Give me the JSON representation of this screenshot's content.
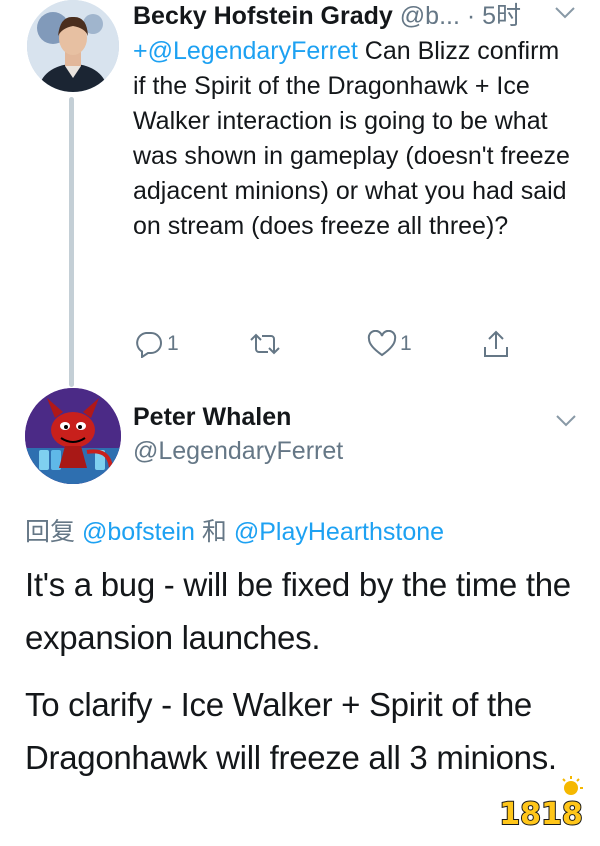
{
  "reply_tweet": {
    "author_name": "Becky Hofstein Grady",
    "author_handle": "@b...",
    "separator": "·",
    "time": "5时",
    "mention": "+@LegendaryFerret",
    "text": " Can Blizz confirm if the Spirit of the Dragonhawk + Ice Walker interaction is going to be what was shown in gameplay (doesn't freeze adjacent minions) or what you had said on stream (does freeze all three)?",
    "replies_count": "1",
    "likes_count": "1",
    "icons": [
      "reply-icon",
      "retweet-icon",
      "like-icon",
      "share-icon",
      "chevron-down-icon"
    ]
  },
  "main_tweet": {
    "author_name": "Peter Whalen",
    "author_handle": "@LegendaryFerret",
    "reply_prefix": "回复",
    "reply_to_1": "@bofstein",
    "reply_join": "和",
    "reply_to_2": "@PlayHearthstone",
    "paragraph_1": "It's a bug - will be fixed by the time the expansion launches.",
    "paragraph_2": "To clarify - Ice Walker + Spirit of the Dragonhawk will freeze all 3 minions."
  },
  "watermark": {
    "text": "1818"
  },
  "colors": {
    "link": "#1da1f2",
    "secondary_text": "#657786",
    "thread_line": "#c4cfd6"
  }
}
